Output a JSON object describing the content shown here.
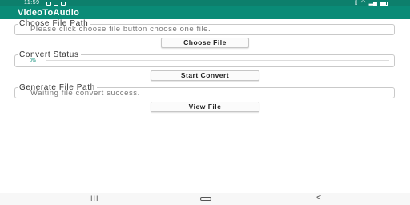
{
  "status_bar": {
    "time": "11:59"
  },
  "app": {
    "title": "VideoToAudio"
  },
  "choose_section": {
    "title": "Choose File Path",
    "text": "Please click choose file button choose one file.",
    "button_label": "Choose File"
  },
  "convert_section": {
    "title": "Convert Status",
    "progress_text": "0%",
    "progress": 0,
    "button_label": "Start Convert"
  },
  "generate_section": {
    "title": "Generate File Path",
    "text": "Waiting file convert success.",
    "button_label": "View File"
  },
  "nav": {
    "recent_glyph": "III",
    "back_glyph": "<"
  },
  "colors": {
    "accent": "#0a8b77",
    "status_bar": "#0d7f6c"
  }
}
